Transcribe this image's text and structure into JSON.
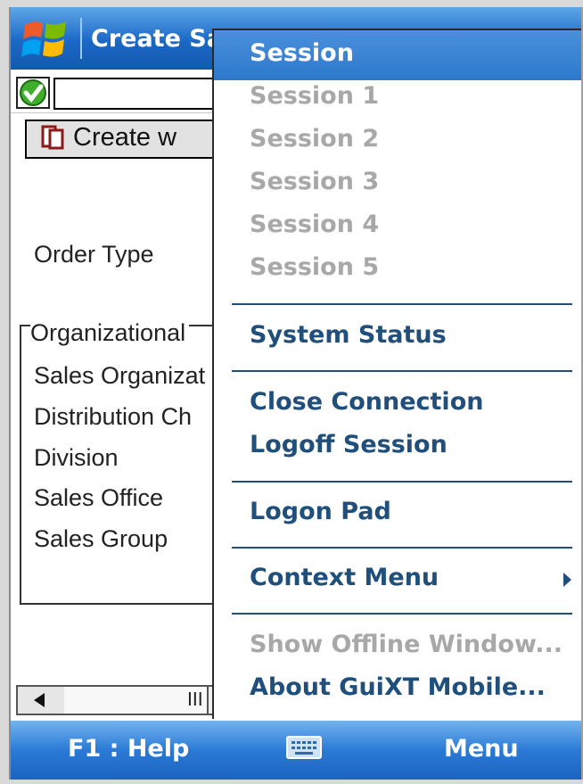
{
  "titlebar": {
    "title": "Create Sa"
  },
  "tab": {
    "label": "Create w"
  },
  "form": {
    "order_type_label": "Order Type",
    "group_title": "Organizational",
    "fields": [
      "Sales Organizat",
      "Distribution Ch",
      "Division",
      "Sales Office",
      "Sales Group"
    ]
  },
  "menu": {
    "header": "Session",
    "sessions": [
      "Session 1",
      "Session 2",
      "Session 3",
      "Session 4",
      "Session 5"
    ],
    "system_status": "System Status",
    "close_connection": "Close Connection",
    "logoff_session": "Logoff Session",
    "logon_pad": "Logon Pad",
    "context_menu": "Context Menu",
    "show_offline_window": "Show Offline Window...",
    "about": "About GuiXT Mobile..."
  },
  "softkeys": {
    "left": "F1 : Help",
    "right": "Menu"
  },
  "scrollbar": {
    "grip": "III"
  },
  "colors": {
    "menu_text": "#1f4f7a",
    "disabled_text": "#a8a8a8",
    "bar_blue": "#2a7ad6"
  }
}
